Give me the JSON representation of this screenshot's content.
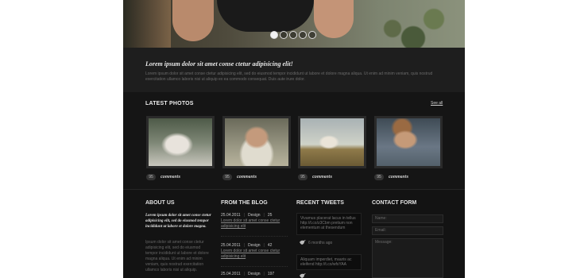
{
  "slider": {
    "dots": 5,
    "active_index": 0
  },
  "intro": {
    "title": "Lorem ipsum dolor sit amet conse ctetur adipisicing elit!",
    "text": "Lorem ipsum dolor sit amet conse ctetur adipisicing elit, sed do eiusmod tempor incididunt ut labore et dolore magna aliqua. Ut enim ad minim veniam, quis nostrud exercitation ullamco laboris nisi ut aliquip ex ea commodo consequat. Duis aute irure dolor."
  },
  "latest_photos": {
    "title": "LATEST PHOTOS",
    "see_all": "See all",
    "items": [
      {
        "count": "95",
        "label": "comments"
      },
      {
        "count": "95",
        "label": "comments"
      },
      {
        "count": "95",
        "label": "comments"
      },
      {
        "count": "95",
        "label": "comments"
      }
    ]
  },
  "about": {
    "title": "ABOUT US",
    "intro": "Lorem ipsum dolor sit amet conse ctetur adipisicing elit, sed do eiusmod tempor incididunt ut labore et dolore magna.",
    "text": "Ipsum dolor sit amet conse ctetur adipisicing elit, sed do eiusmod tempor incididunt ut labore et dolore magna aliqua. Ut enim ad minim veniam, quis nostrud exercitation ullamco laboris nisi ut aliquip."
  },
  "blog": {
    "title": "FROM THE BLOG",
    "items": [
      {
        "date": "25.04.2011",
        "category": "Design",
        "comments": "25",
        "link": "Lorem dolor sit amet conse ctetur adipisicing elit"
      },
      {
        "date": "25.04.2011",
        "category": "Design",
        "comments": "42",
        "link": "Lorem dolor sit amet conse ctetur adipisicing elit"
      },
      {
        "date": "25.04.2011",
        "category": "Design",
        "comments": "197"
      }
    ]
  },
  "tweets": {
    "title": "RECENT TWEETS",
    "items": [
      {
        "text": "Vivamus placerat lacus in tellus http://t.co/z3Cbm pretium non elementum at thesendum",
        "time": "6 months ago"
      },
      {
        "text": "Aliquam imperdiet, mauris ac eleifend http://t.co/wfsYAA",
        "time": ""
      }
    ]
  },
  "contact": {
    "title": "CONTACT FORM",
    "name_placeholder": "Name:",
    "email_placeholder": "Email:",
    "message_placeholder": "Message:"
  },
  "colors": {
    "page_bg": "#151515",
    "footer_bg": "#131313",
    "text_light": "#e8e8e8",
    "text_muted": "#6a6a6a"
  }
}
